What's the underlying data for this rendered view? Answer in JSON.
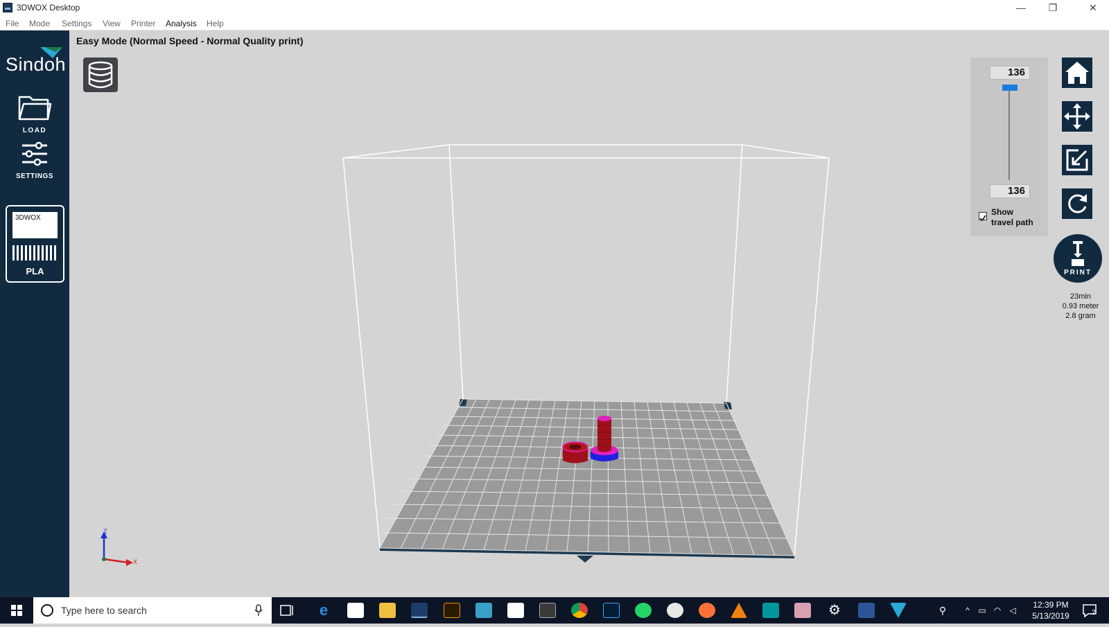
{
  "window": {
    "title": "3DWOX Desktop",
    "minimize_glyph": "—",
    "restore_glyph": "❐",
    "close_glyph": "✕"
  },
  "menu": [
    "File",
    "Mode",
    "Settings",
    "View",
    "Printer",
    "Analysis",
    "Help"
  ],
  "sidebar": {
    "logo": "Sindoh",
    "load_label": "LOAD",
    "settings_label": "SETTINGS",
    "material": {
      "cartridge_brand": "3DWOX",
      "name": "PLA"
    }
  },
  "main": {
    "mode_text": "Easy Mode (Normal Speed - Normal Quality print)"
  },
  "layer_panel": {
    "top_layer": "136",
    "bottom_layer": "136",
    "show_travel_path_line1": "Show",
    "show_travel_path_line2": "travel path",
    "show_travel_path_checked": true
  },
  "print": {
    "label": "PRINT",
    "time": "23min",
    "length": "0.93 meter",
    "weight": "2.8 gram"
  },
  "axes": {
    "z": "Z",
    "x": "X"
  },
  "taskbar": {
    "search_placeholder": "Type here to search",
    "time": "12:39 PM",
    "date": "5/13/2019",
    "notification_count": "2",
    "pinned_apps": [
      "edge",
      "store",
      "file-explorer",
      "3dwox",
      "illustrator",
      "snipping",
      "mail",
      "calculator",
      "chrome",
      "photoshop",
      "whatsapp",
      "paint",
      "firefox",
      "vlc",
      "arduino",
      "image-app",
      "settings",
      "word",
      "sindoh"
    ]
  },
  "colors": {
    "sidebar": "#112a40",
    "viewport_bg": "#d4d4d4",
    "model_red": "#a0101a",
    "model_magenta": "#e020c0",
    "model_blue": "#2020e0",
    "slider_accent": "#1a7ae0"
  }
}
